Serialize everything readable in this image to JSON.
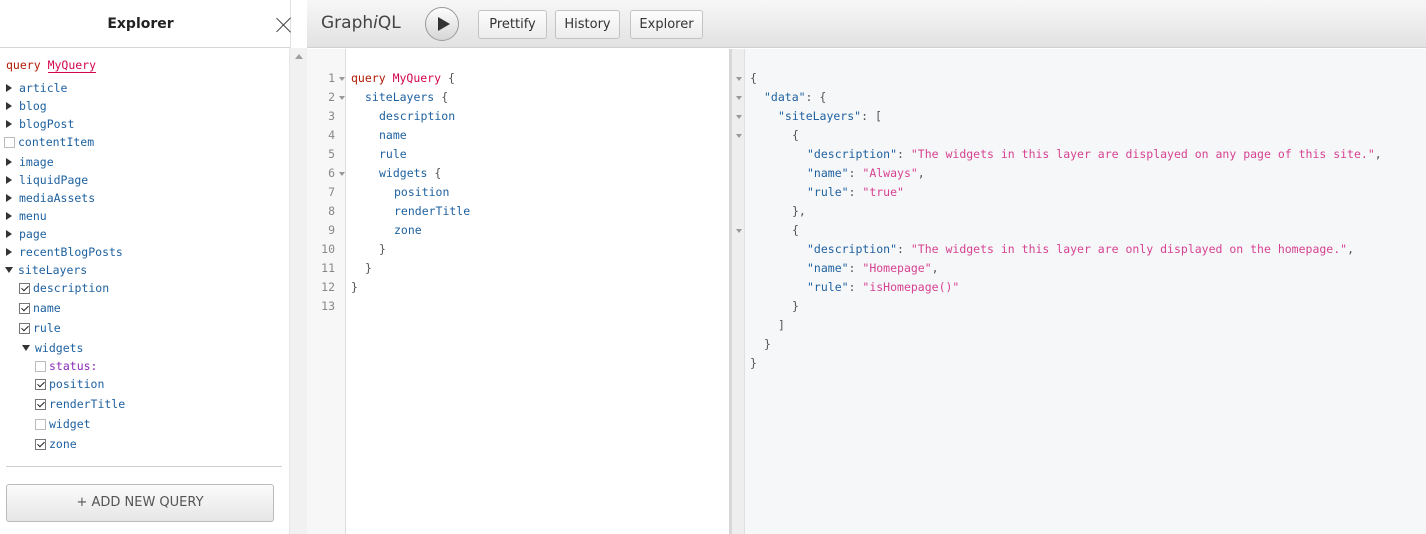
{
  "explorer": {
    "title": "Explorer",
    "query_keyword": "query",
    "query_name": "MyQuery",
    "fields": [
      {
        "label": "article",
        "state": "collapsed"
      },
      {
        "label": "blog",
        "state": "collapsed"
      },
      {
        "label": "blogPost",
        "state": "collapsed"
      },
      {
        "label": "contentItem",
        "state": "unchecked"
      },
      {
        "label": "image",
        "state": "collapsed"
      },
      {
        "label": "liquidPage",
        "state": "collapsed"
      },
      {
        "label": "mediaAssets",
        "state": "collapsed"
      },
      {
        "label": "menu",
        "state": "collapsed"
      },
      {
        "label": "page",
        "state": "collapsed"
      },
      {
        "label": "recentBlogPosts",
        "state": "collapsed"
      },
      {
        "label": "siteLayers",
        "state": "expanded"
      }
    ],
    "siteLayers_fields": [
      {
        "label": "description",
        "checked": true
      },
      {
        "label": "name",
        "checked": true
      },
      {
        "label": "rule",
        "checked": true
      },
      {
        "label": "widgets",
        "state": "expanded"
      }
    ],
    "widgets_fields": [
      {
        "label": "status:",
        "checked": false,
        "is_arg": true
      },
      {
        "label": "position",
        "checked": true
      },
      {
        "label": "renderTitle",
        "checked": true
      },
      {
        "label": "widget",
        "checked": false
      },
      {
        "label": "zone",
        "checked": true
      }
    ],
    "add_query_label": "+ ADD NEW QUERY"
  },
  "toolbar": {
    "logo_pre": "Graph",
    "logo_i": "i",
    "logo_post": "QL",
    "prettify_label": "Prettify",
    "history_label": "History",
    "explorer_label": "Explorer"
  },
  "editor": {
    "line_numbers": [
      "1",
      "2",
      "3",
      "4",
      "5",
      "6",
      "7",
      "8",
      "9",
      "10",
      "11",
      "12",
      "13"
    ],
    "lines": [
      {
        "kw": "query",
        "def": "MyQuery",
        "punc": "{"
      },
      {
        "field": "siteLayers",
        "punc": "{"
      },
      {
        "field": "description"
      },
      {
        "field": "name"
      },
      {
        "field": "rule"
      },
      {
        "field": "widgets",
        "punc": "{"
      },
      {
        "field": "position"
      },
      {
        "field": "renderTitle"
      },
      {
        "field": "zone"
      },
      {
        "punc": "}"
      },
      {
        "punc": "}"
      },
      {
        "punc": "}"
      },
      {}
    ]
  },
  "result": {
    "open_brace": "{",
    "data_key": "\"data\"",
    "siteLayers_key": "\"siteLayers\"",
    "items": [
      {
        "description": "\"The widgets in this layer are displayed on any page of this site.\"",
        "name": "\"Always\"",
        "rule": "\"true\""
      },
      {
        "description": "\"The widgets in this layer are only displayed on the homepage.\"",
        "name": "\"Homepage\"",
        "rule": "\"isHomepage()\""
      }
    ],
    "description_key": "\"description\"",
    "name_key": "\"name\"",
    "rule_key": "\"rule\""
  },
  "colors": {
    "keyword": "#b11a04",
    "definition": "#d2054e",
    "field": "#1f61a0",
    "string": "#d64292"
  }
}
